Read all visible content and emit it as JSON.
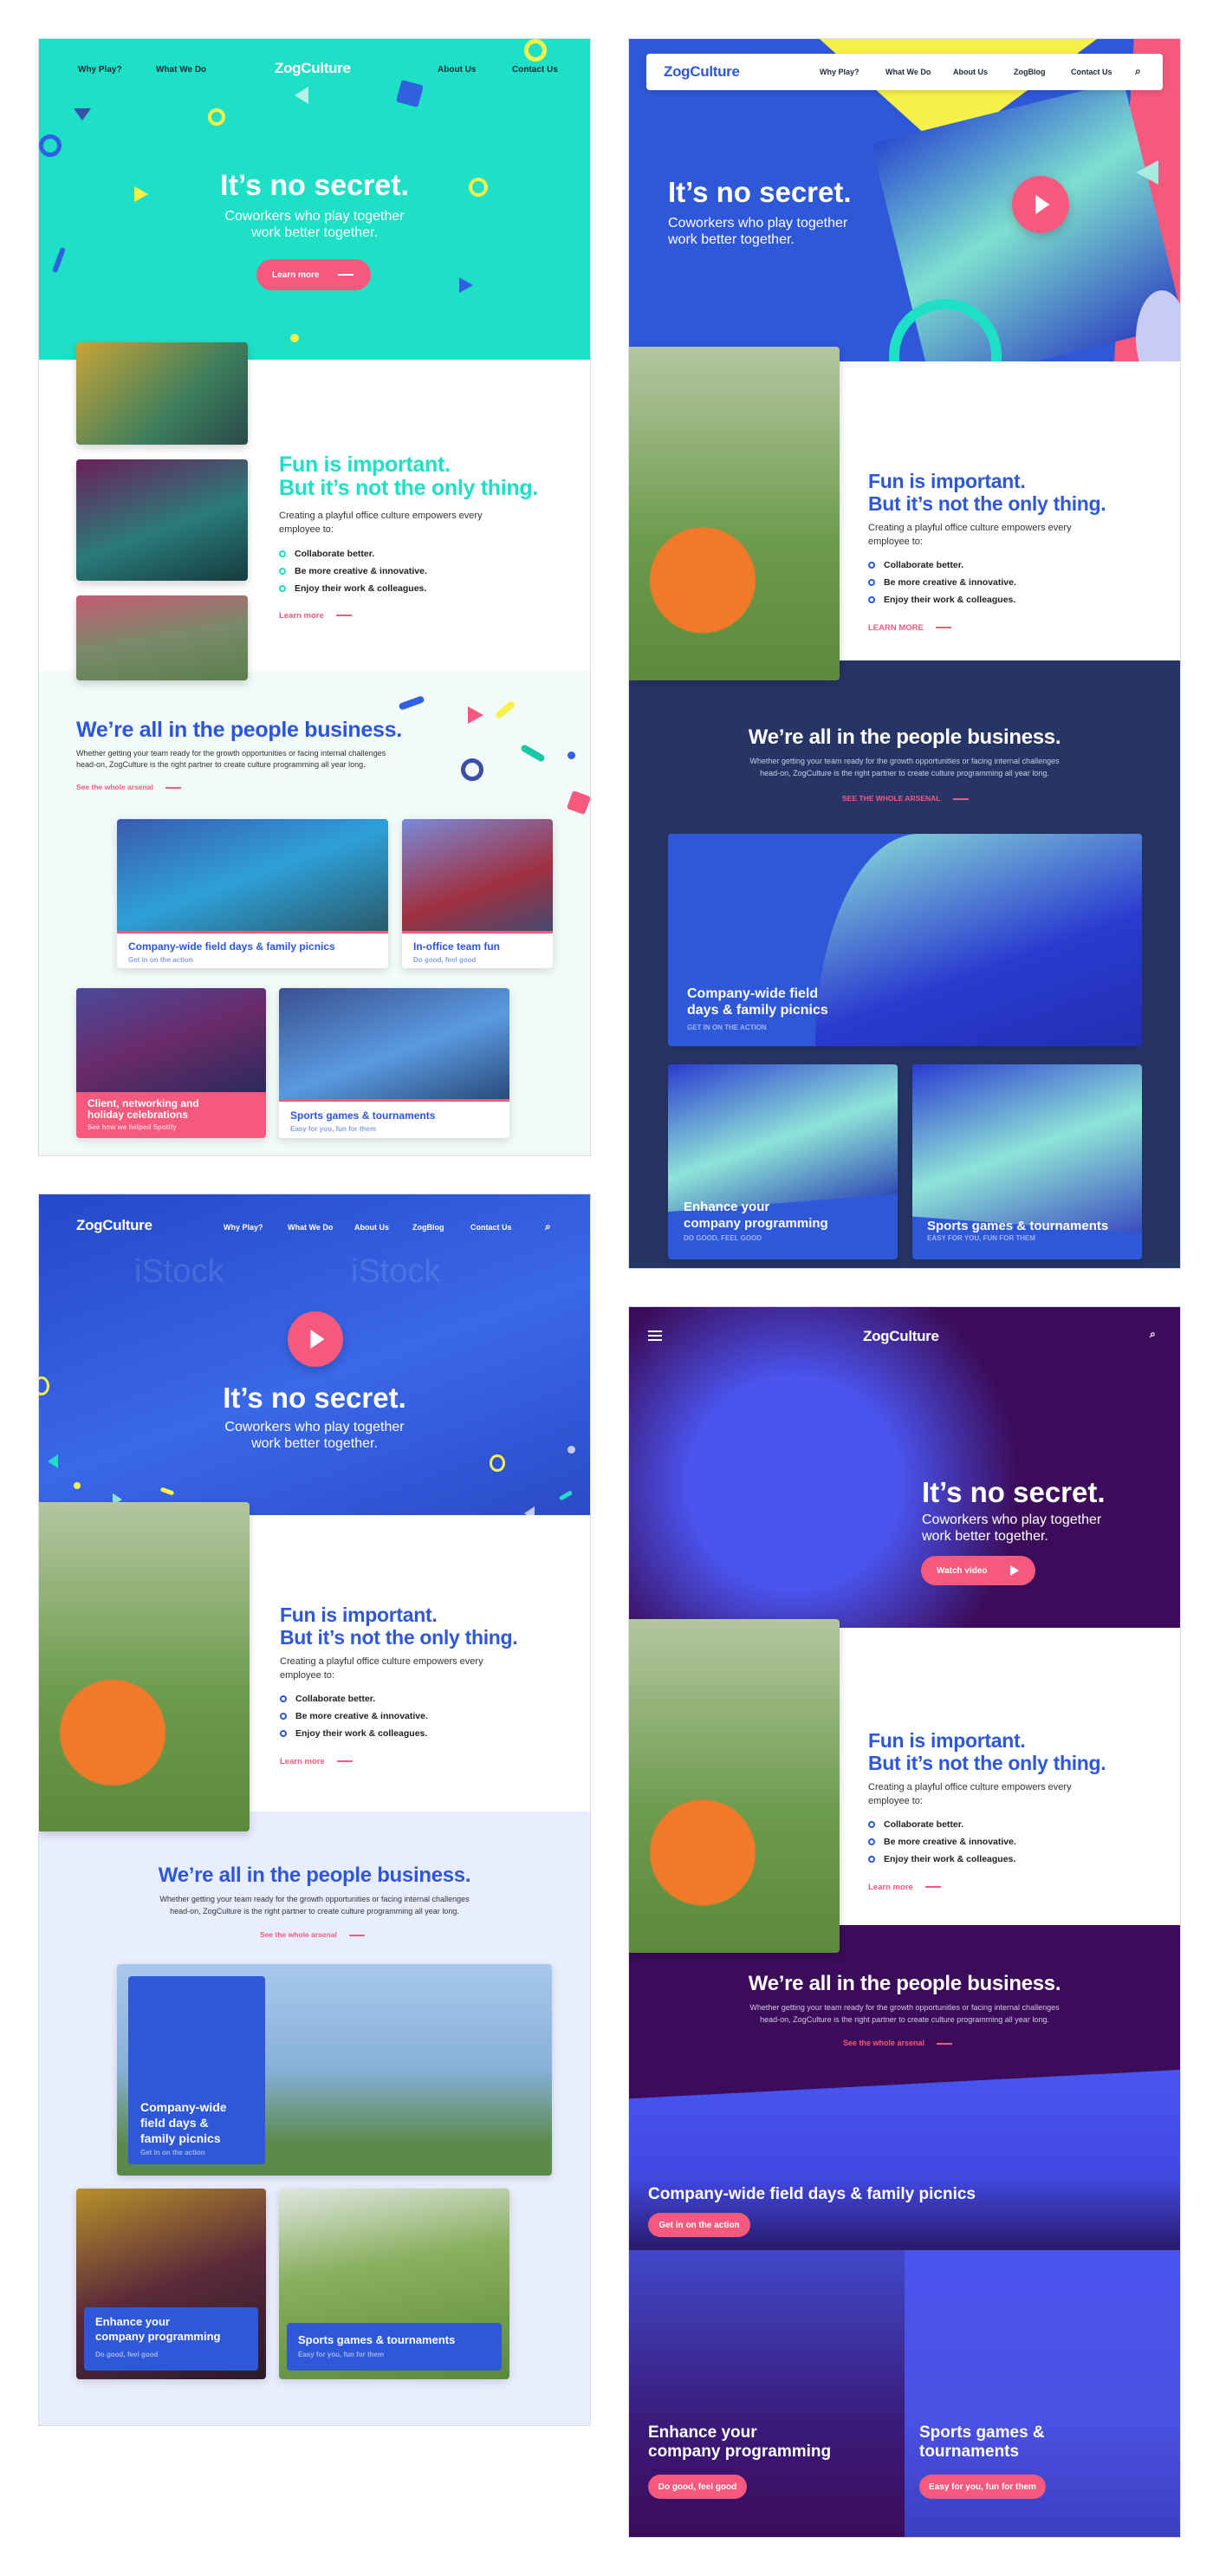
{
  "brand": {
    "name": "ZogCulture"
  },
  "colors": {
    "teal": "#1de0c6",
    "blue": "#3060e0",
    "pink": "#f55a7e",
    "yellow": "#f8f14a",
    "navy": "#263566",
    "purple": "#3c0c5a",
    "violet": "#4a55f0"
  },
  "variants": [
    {
      "nav": {
        "items": [
          "Why Play?",
          "What We Do",
          "About Us",
          "Contact Us"
        ]
      },
      "hero": {
        "title": "It’s no secret.",
        "subtitle_1": "Coworkers who play together",
        "subtitle_2": "work better together.",
        "cta": "Learn more"
      },
      "fun": {
        "title_1": "Fun is important.",
        "title_2": "But it’s not the only thing.",
        "body": "Creating a playful office culture empowers every employee to:",
        "bullets": [
          "Collaborate better.",
          "Be more creative & innovative.",
          "Enjoy their work & colleagues."
        ],
        "link": "Learn more"
      },
      "people": {
        "title": "We’re all in the people business.",
        "body": "Whether getting your team ready for the growth opportunities or facing internal challenges head-on, ZogCulture is the right partner to create culture programming all year long.",
        "link": "See the whole arsenal"
      },
      "cards": [
        {
          "title": "Company-wide field days & family picnics",
          "sub": "Get in on the action"
        },
        {
          "title": "In-office team fun",
          "sub": "Do good, feel good"
        },
        {
          "title_1": "Client, networking and",
          "title_2": "holiday celebrations",
          "sub": "See how we helped Spotify"
        },
        {
          "title": "Sports games & tournaments",
          "sub": "Easy for you, fun for them"
        }
      ]
    },
    {
      "nav": {
        "items": [
          "Why Play?",
          "What We Do",
          "About Us",
          "ZogBlog",
          "Contact Us"
        ],
        "search": "search-icon"
      },
      "hero": {
        "title": "It’s no secret.",
        "subtitle_1": "Coworkers who play together",
        "subtitle_2": "work better together."
      },
      "fun": {
        "title_1": "Fun is important.",
        "title_2": "But it’s not the only thing.",
        "body": "Creating a playful office culture empowers every employee to:",
        "bullets": [
          "Collaborate better.",
          "Be more creative & innovative.",
          "Enjoy their work & colleagues."
        ],
        "link": "LEARN MORE"
      },
      "people": {
        "title": "We’re all in the people business.",
        "body_1": "Whether getting your team ready for the growth opportunities or facing internal challenges",
        "body_2": "head-on, ZogCulture is the right partner to create culture programming all year long.",
        "link": "SEE THE WHOLE ARSENAL"
      },
      "cards": [
        {
          "title_1": "Company-wide field",
          "title_2": "days & family picnics",
          "sub": "GET IN ON THE ACTION"
        },
        {
          "title_1": "Enhance your",
          "title_2": "company programming",
          "sub": "DO GOOD, FEEL GOOD"
        },
        {
          "title": "Sports games & tournaments",
          "sub": "EASY FOR YOU, FUN FOR THEM"
        }
      ]
    },
    {
      "nav": {
        "items": [
          "Why Play?",
          "What We Do",
          "About Us",
          "ZogBlog",
          "Contact Us"
        ],
        "search": "search-icon"
      },
      "hero": {
        "title": "It’s no secret.",
        "subtitle_1": "Coworkers who play together",
        "subtitle_2": "work better together.",
        "watermark": "iStock"
      },
      "fun": {
        "title_1": "Fun is important.",
        "title_2": "But it’s not the only thing.",
        "body": "Creating a playful office culture empowers every employee to:",
        "bullets": [
          "Collaborate better.",
          "Be more creative & innovative.",
          "Enjoy their work & colleagues."
        ],
        "link": "Learn more"
      },
      "people": {
        "title": "We’re all in the people business.",
        "body_1": "Whether getting your team ready for the growth opportunities or facing internal challenges",
        "body_2": "head-on, ZogCulture is the right partner to create culture programming all year long.",
        "link": "See the whole arsenal"
      },
      "cards": [
        {
          "title_1": "Company-wide",
          "title_2": "field days &",
          "title_3": "family picnics",
          "sub": "Get in on the action"
        },
        {
          "title_1": "Enhance your",
          "title_2": "company programming",
          "sub": "Do good, feel good"
        },
        {
          "title": "Sports games & tournaments",
          "sub": "Easy for you, fun for them"
        }
      ]
    },
    {
      "nav": {
        "menu": "hamburger-icon",
        "search": "search-icon"
      },
      "hero": {
        "title": "It’s no secret.",
        "subtitle_1": "Coworkers who play together",
        "subtitle_2": "work better together.",
        "cta": "Watch video"
      },
      "fun": {
        "title_1": "Fun is important.",
        "title_2": "But it’s not the only thing.",
        "body": "Creating a playful office culture empowers every employee to:",
        "bullets": [
          "Collaborate better.",
          "Be more creative & innovative.",
          "Enjoy their work & colleagues."
        ],
        "link": "Learn more"
      },
      "people": {
        "title": "We’re all in the people business.",
        "body_1": "Whether getting your team ready for the growth opportunities or facing internal challenges",
        "body_2": "head-on, ZogCulture is the right partner to create culture programming all year long.",
        "link": "See the whole arsenal"
      },
      "cards": [
        {
          "title": "Company-wide field days & family picnics",
          "cta": "Get in on the action"
        },
        {
          "title_1": "Enhance your",
          "title_2": "company programming",
          "cta": "Do good, feel good"
        },
        {
          "title_1": "Sports games &",
          "title_2": "tournaments",
          "cta": "Easy for you, fun for them"
        }
      ]
    }
  ]
}
